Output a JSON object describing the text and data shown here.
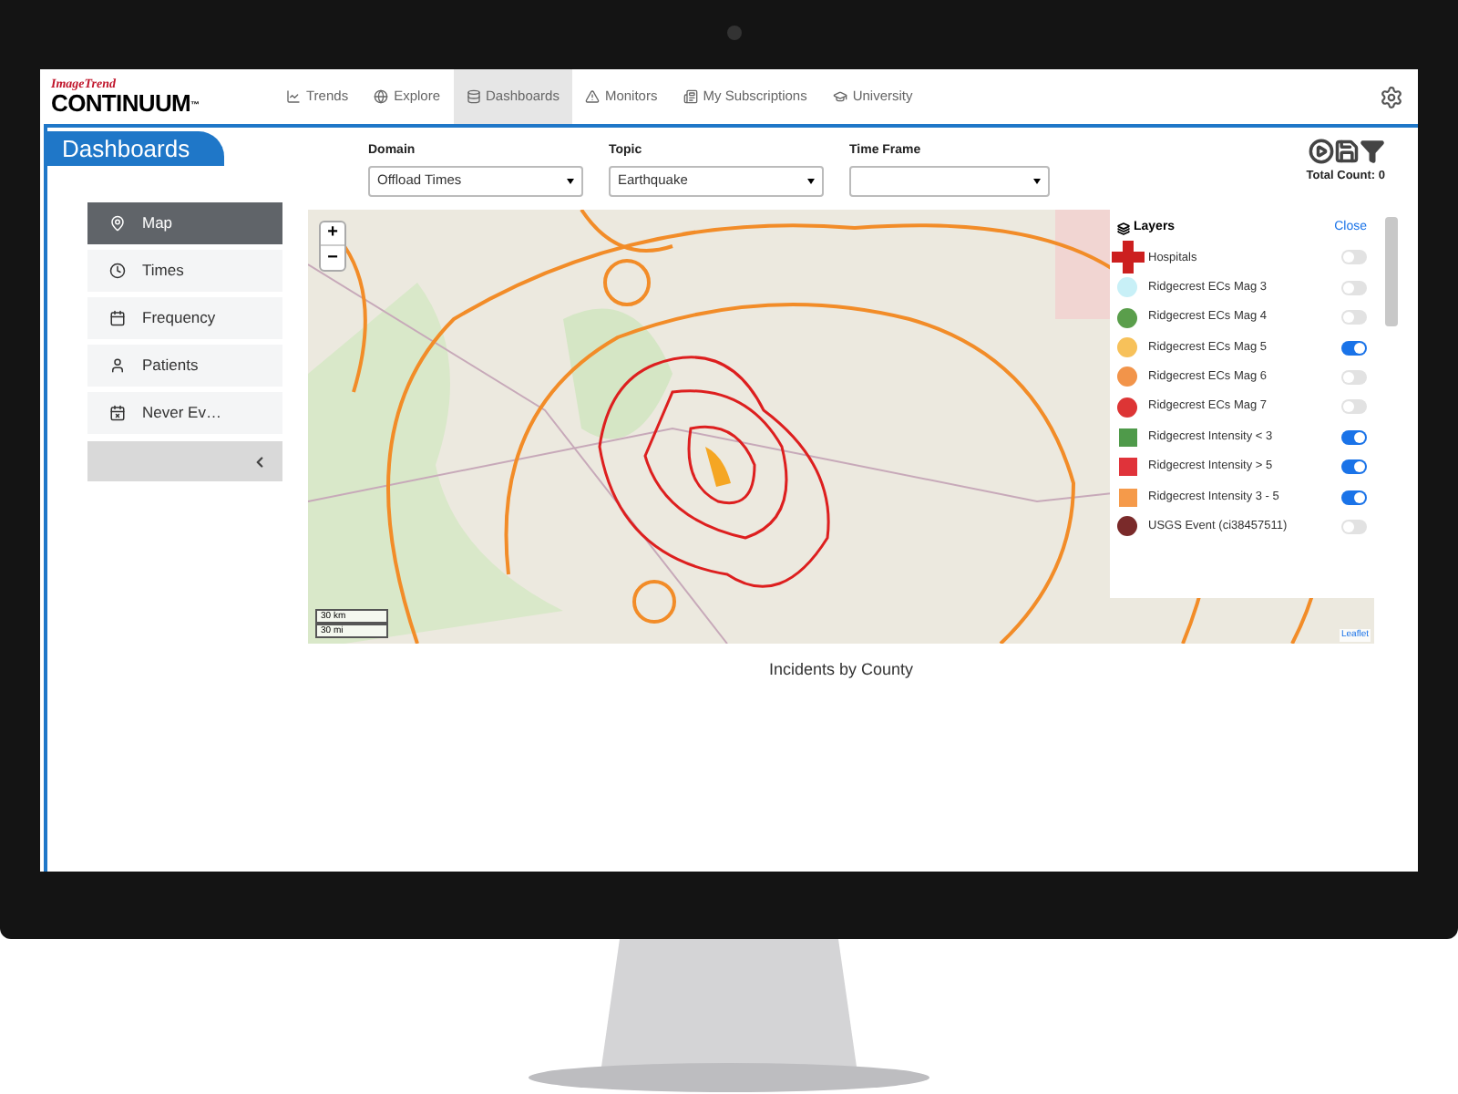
{
  "nav": {
    "logo_top": "ImageTrend",
    "logo_main": "CONTINUUM",
    "logo_mark": "™",
    "tabs": [
      {
        "label": "Trends",
        "selected": false
      },
      {
        "label": "Explore",
        "selected": false
      },
      {
        "label": "Dashboards",
        "selected": true
      },
      {
        "label": "Monitors",
        "selected": false
      },
      {
        "label": "My Subscriptions",
        "selected": false
      },
      {
        "label": "University",
        "selected": false
      }
    ]
  },
  "header": {
    "title": "Dashboards",
    "total_count": "Total Count: 0"
  },
  "filters": [
    {
      "label": "Domain",
      "value": "Offload Times"
    },
    {
      "label": "Topic",
      "value": "Earthquake"
    },
    {
      "label": "Time Frame"
    }
  ],
  "sidebar": {
    "items": [
      {
        "label": "Map",
        "selected": true
      },
      {
        "label": "Times",
        "selected": false
      },
      {
        "label": "Frequency",
        "selected": false
      },
      {
        "label": "Patients",
        "selected": false
      },
      {
        "label": "Never Ev…",
        "selected": false
      }
    ]
  },
  "map": {
    "zoom_in": "+",
    "zoom_out": "−",
    "scale": [
      "30 km",
      "30 mi"
    ],
    "attribution": "Leaflet",
    "layers": {
      "title": "Layers",
      "close": "Close",
      "items": [
        {
          "label": "Hospitals",
          "kind": "cross",
          "color": "#cc1f1f",
          "on": false
        },
        {
          "label": "Ridgecrest ECs Mag 3",
          "kind": "circle",
          "color": "#c8f0f7",
          "on": false
        },
        {
          "label": "Ridgecrest ECs Mag 4",
          "kind": "circle",
          "color": "#5a9e4b",
          "on": false
        },
        {
          "label": "Ridgecrest ECs Mag 5",
          "kind": "circle",
          "color": "#f7c15a",
          "on": true
        },
        {
          "label": "Ridgecrest ECs Mag 6",
          "kind": "circle",
          "color": "#f2944a",
          "on": false
        },
        {
          "label": "Ridgecrest ECs Mag 7",
          "kind": "circle",
          "color": "#dd3535",
          "on": false
        },
        {
          "label": "Ridgecrest Intensity < 3",
          "kind": "square",
          "color": "#4f9a4a",
          "on": true
        },
        {
          "label": "Ridgecrest Intensity > 5",
          "kind": "square",
          "color": "#e0333a",
          "on": true
        },
        {
          "label": "Ridgecrest Intensity 3 - 5",
          "kind": "square",
          "color": "#f59a4a",
          "on": true
        },
        {
          "label": "USGS Event (ci38457511)",
          "kind": "circle",
          "color": "#7a2a2a",
          "on": false
        }
      ]
    }
  },
  "chart_title": "Incidents by County"
}
